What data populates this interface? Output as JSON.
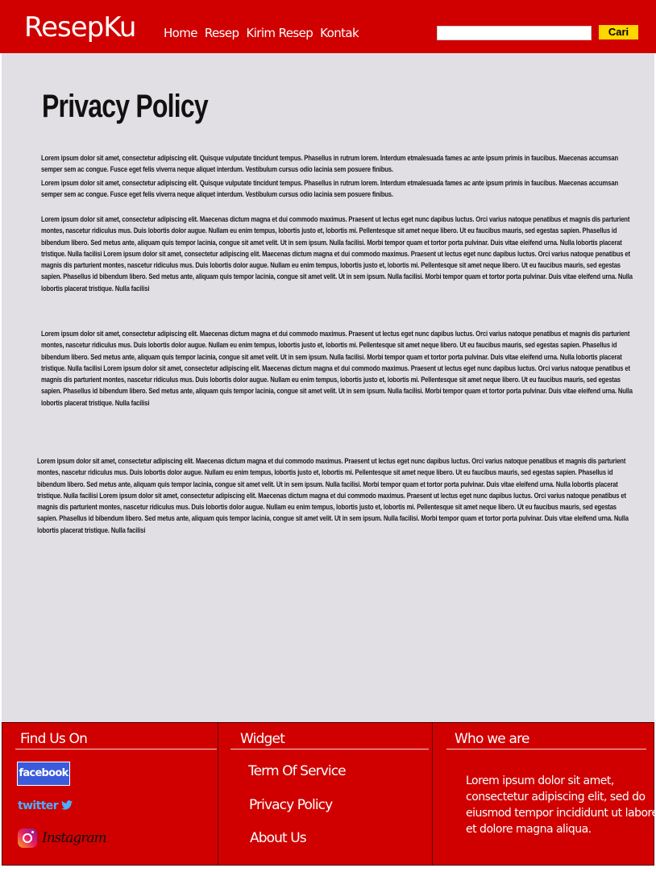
{
  "header": {
    "logo": "ResepKu",
    "nav": [
      "Home",
      "Resep",
      "Kirim Resep",
      "Kontak"
    ],
    "search": {
      "value": "",
      "button_label": "Cari"
    }
  },
  "main": {
    "title": "Privacy Policy",
    "paragraphs": [
      "Lorem ipsum dolor sit amet, consectetur adipiscing elit. Quisque vulputate tincidunt tempus. Phasellus in rutrum lorem. Interdum etmalesuada fames ac ante ipsum primis in faucibus. Maecenas accumsan semper sem ac congue. Fusce eget felis viverra neque aliquet interdum. Vestibulum cursus odio lacinia sem posuere finibus.",
      "Lorem ipsum dolor sit amet, consectetur adipiscing elit. Quisque vulputate tincidunt tempus. Phasellus in rutrum lorem. Interdum etmalesuada fames ac ante ipsum primis in faucibus. Maecenas accumsan semper sem ac congue. Fusce eget felis viverra neque aliquet interdum. Vestibulum cursus odio lacinia sem posuere finibus.",
      "Lorem ipsum dolor sit amet, consectetur adipiscing elit. Maecenas dictum magna et dui commodo maximus. Praesent ut lectus eget nunc dapibus luctus. Orci varius natoque penatibus et magnis dis parturient montes, nascetur ridiculus mus. Duis lobortis dolor augue. Nullam eu enim tempus, lobortis justo et, lobortis mi. Pellentesque sit amet neque libero. Ut eu faucibus mauris, sed egestas sapien. Phasellus id bibendum libero. Sed metus ante, aliquam quis tempor lacinia, congue sit amet velit. Ut in sem ipsum. Nulla facilisi. Morbi tempor quam et tortor porta pulvinar. Duis vitae eleifend urna. Nulla lobortis placerat tristique. Nulla facilisi Lorem ipsum dolor sit amet, consectetur adipiscing elit. Maecenas dictum magna et dui commodo maximus. Praesent ut lectus eget nunc dapibus luctus. Orci varius natoque penatibus et magnis dis parturient montes, nascetur ridiculus mus. Duis lobortis dolor augue. Nullam eu enim tempus, lobortis justo et, lobortis mi. Pellentesque sit amet neque libero. Ut eu faucibus mauris, sed egestas sapien. Phasellus id bibendum libero. Sed metus ante, aliquam quis tempor lacinia, congue sit amet velit. Ut in sem ipsum. Nulla facilisi. Morbi tempor quam et tortor porta pulvinar. Duis vitae eleifend urna. Nulla lobortis placerat tristique. Nulla facilisi",
      "Lorem ipsum dolor sit amet, consectetur adipiscing elit. Maecenas dictum magna et dui commodo maximus. Praesent ut lectus eget nunc dapibus luctus. Orci varius natoque penatibus et magnis dis parturient montes, nascetur ridiculus mus. Duis lobortis dolor augue. Nullam eu enim tempus, lobortis justo et, lobortis mi. Pellentesque sit amet neque libero. Ut eu faucibus mauris, sed egestas sapien. Phasellus id bibendum libero. Sed metus ante, aliquam quis tempor lacinia, congue sit amet velit. Ut in sem ipsum. Nulla facilisi. Morbi tempor quam et tortor porta pulvinar. Duis vitae eleifend urna. Nulla lobortis placerat tristique. Nulla facilisi Lorem ipsum dolor sit amet, consectetur adipiscing elit. Maecenas dictum magna et dui commodo maximus. Praesent ut lectus eget nunc dapibus luctus. Orci varius natoque penatibus et magnis dis parturient montes, nascetur ridiculus mus. Duis lobortis dolor augue. Nullam eu enim tempus, lobortis justo et, lobortis mi. Pellentesque sit amet neque libero. Ut eu faucibus mauris, sed egestas sapien. Phasellus id bibendum libero. Sed metus ante, aliquam quis tempor lacinia, congue sit amet velit. Ut in sem ipsum. Nulla facilisi. Morbi tempor quam et tortor porta pulvinar. Duis vitae eleifend urna. Nulla lobortis placerat tristique. Nulla facilisi",
      "Lorem ipsum dolor sit amet, consectetur adipiscing elit. Maecenas dictum magna et dui commodo maximus. Praesent ut lectus eget nunc dapibus luctus. Orci varius natoque penatibus et magnis dis parturient montes, nascetur ridiculus mus. Duis lobortis dolor augue. Nullam eu enim tempus, lobortis justo et, lobortis mi. Pellentesque sit amet neque libero. Ut eu faucibus mauris, sed egestas sapien. Phasellus id bibendum libero. Sed metus ante, aliquam quis tempor lacinia, congue sit amet velit. Ut in sem ipsum. Nulla facilisi. Morbi tempor quam et tortor porta pulvinar. Duis vitae eleifend urna. Nulla lobortis placerat tristique. Nulla facilisi Lorem ipsum dolor sit amet, consectetur adipiscing elit. Maecenas dictum magna et dui commodo maximus. Praesent ut lectus eget nunc dapibus luctus. Orci varius natoque penatibus et magnis dis parturient montes, nascetur ridiculus mus. Duis lobortis dolor augue. Nullam eu enim tempus, lobortis justo et, lobortis mi. Pellentesque sit amet neque libero. Ut eu faucibus mauris, sed egestas sapien. Phasellus id bibendum libero. Sed metus ante, aliquam quis tempor lacinia, congue sit amet velit. Ut in sem ipsum. Nulla facilisi. Morbi tempor quam et tortor porta pulvinar. Duis vitae eleifend urna. Nulla lobortis placerat tristique. Nulla facilisi"
    ]
  },
  "footer": {
    "find_us": {
      "title": "Find Us On",
      "facebook": "facebook",
      "twitter": "twitter",
      "instagram": "Instagram"
    },
    "widget": {
      "title": "Widget",
      "links": [
        "Term Of Service",
        "Privacy Policy",
        "About Us"
      ]
    },
    "who": {
      "title": "Who we are",
      "text": "Lorem ipsum dolor sit amet, consectetur adipiscing elit, sed do eiusmod tempor incididunt ut labore et dolore magna aliqua."
    }
  },
  "colors": {
    "brand_red": "#d00000",
    "page_bg": "#e1dfe4",
    "search_button": "#ffd700",
    "facebook_blue": "#3b5bdb",
    "twitter_blue": "#47b0ff"
  }
}
